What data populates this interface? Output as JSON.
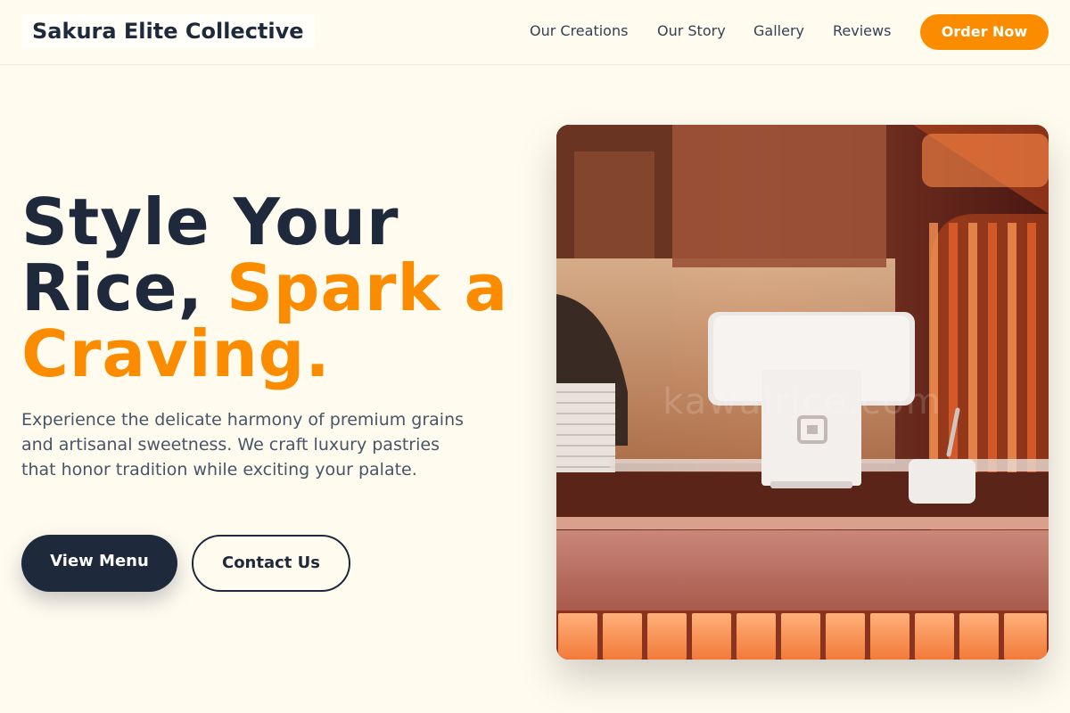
{
  "header": {
    "brand": "Sakura Elite Collective",
    "nav": [
      "Our Creations",
      "Our Story",
      "Gallery",
      "Reviews"
    ],
    "cta": "Order Now"
  },
  "hero": {
    "title_line1": "Style Your",
    "title_line2_dark": "Rice, ",
    "title_line2_accent": "Spark a",
    "title_line3_accent": "Craving.",
    "description": "Experience the delicate harmony of premium grains and artisanal sweetness. We craft luxury pastries that honor tradition while exciting your palate.",
    "primary_button": "View Menu",
    "secondary_button": "Contact Us",
    "image_watermark": "kawairice.com"
  },
  "colors": {
    "accent": "#fb8c00",
    "dark": "#1e293b",
    "background": "#fffbef"
  }
}
